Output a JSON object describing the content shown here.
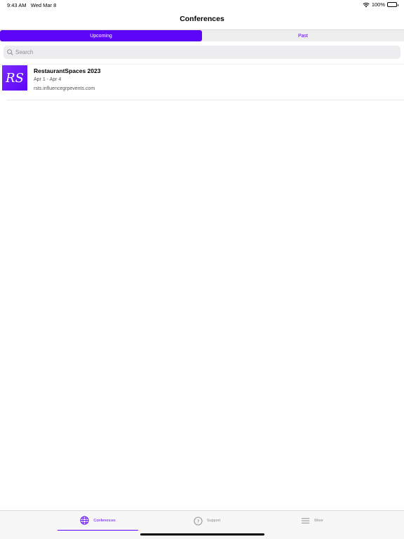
{
  "status_bar": {
    "time": "9:43 AM",
    "date": "Wed Mar 8",
    "battery": "100%",
    "wifi_icon": "wifi-icon",
    "battery_icon": "battery-icon"
  },
  "nav": {
    "title": "Conferences"
  },
  "segments": [
    {
      "label": "Upcoming",
      "selected": true
    },
    {
      "label": "Past",
      "selected": false
    }
  ],
  "search": {
    "placeholder": "Search",
    "value": "",
    "icon": "search-icon"
  },
  "conferences": [
    {
      "logo_text": "RS",
      "title": "RestaurantSpaces 2023",
      "dates": "Apr 1 - Apr 4",
      "url": "rsts.influencegrpevents.com"
    }
  ],
  "tab_bar": {
    "tabs": [
      {
        "label": "Conferences",
        "icon": "globe-icon",
        "selected": true
      },
      {
        "label": "Support",
        "icon": "question-circle-icon",
        "selected": false
      },
      {
        "label": "More",
        "icon": "menu-icon",
        "selected": false
      }
    ]
  },
  "colors": {
    "accent": "#5d05f7",
    "background": "#ffffff",
    "segment_bg": "#eeeeef"
  }
}
